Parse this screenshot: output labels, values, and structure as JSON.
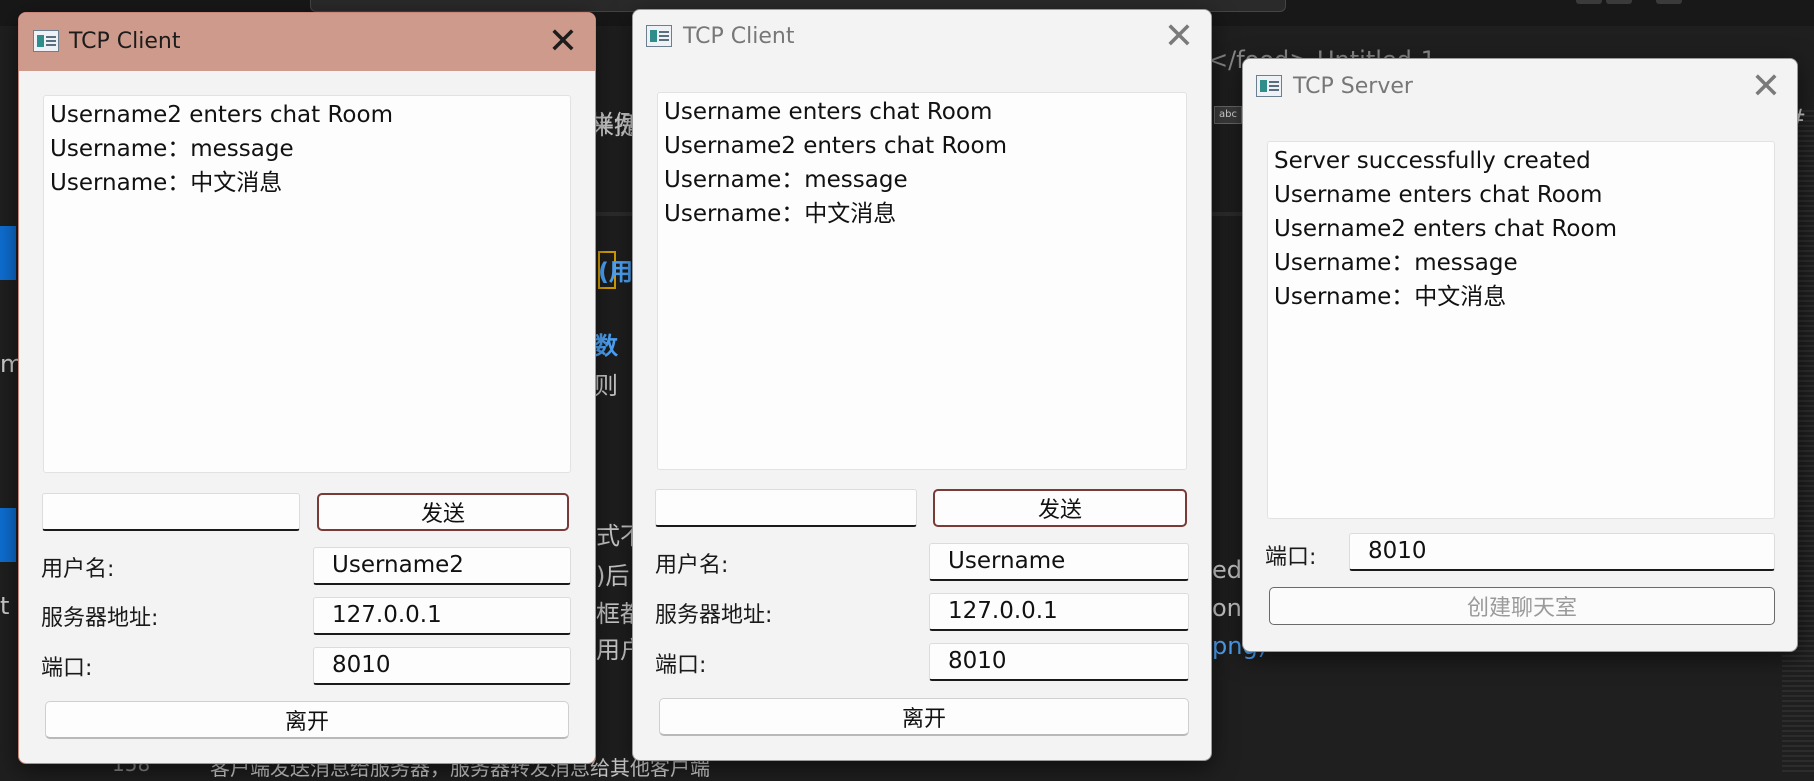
{
  "background": {
    "fragments": [
      "来提",
      "样例",
      "(用",
      "数",
      "则",
      "式不",
      ")后",
      "框都",
      "用户",
      "ed",
      "onS",
      "png)",
      "m",
      "t",
      "</food>  Untitled-1",
      "abc",
      "#",
      "客户端发送消息给服务器，服务器转发消息给其他客户端",
      "158"
    ]
  },
  "client1": {
    "title": "TCP Client",
    "messages": [
      "Username2 enters chat Room",
      "Username：message",
      "Username：中文消息"
    ],
    "message_input": "",
    "send_label": "发送",
    "username_label": "用户名:",
    "username_value": "Username2",
    "server_label": "服务器地址:",
    "server_value": "127.0.0.1",
    "port_label": "端口:",
    "port_value": "8010",
    "leave_label": "离开",
    "close_glyph": "✕"
  },
  "client2": {
    "title": "TCP Client",
    "messages": [
      "Username enters chat Room",
      "Username2 enters chat Room",
      "Username：message",
      "Username：中文消息"
    ],
    "message_input": "",
    "send_label": "发送",
    "username_label": "用户名:",
    "username_value": "Username",
    "server_label": "服务器地址:",
    "server_value": "127.0.0.1",
    "port_label": "端口:",
    "port_value": "8010",
    "leave_label": "离开",
    "close_glyph": "✕"
  },
  "server": {
    "title": "TCP Server",
    "messages": [
      "Server successfully created",
      "Username enters chat Room",
      "Username2 enters chat Room",
      "Username：message",
      "Username：中文消息"
    ],
    "port_label": "端口:",
    "port_value": "8010",
    "create_label": "创建聊天室",
    "close_glyph": "✕"
  },
  "colors": {
    "active_titlebar": "#cd9a8c",
    "send_border": "#7a3a38",
    "editor_bg": "#1f1f1f",
    "accent_blue": "#0e6ed1"
  }
}
